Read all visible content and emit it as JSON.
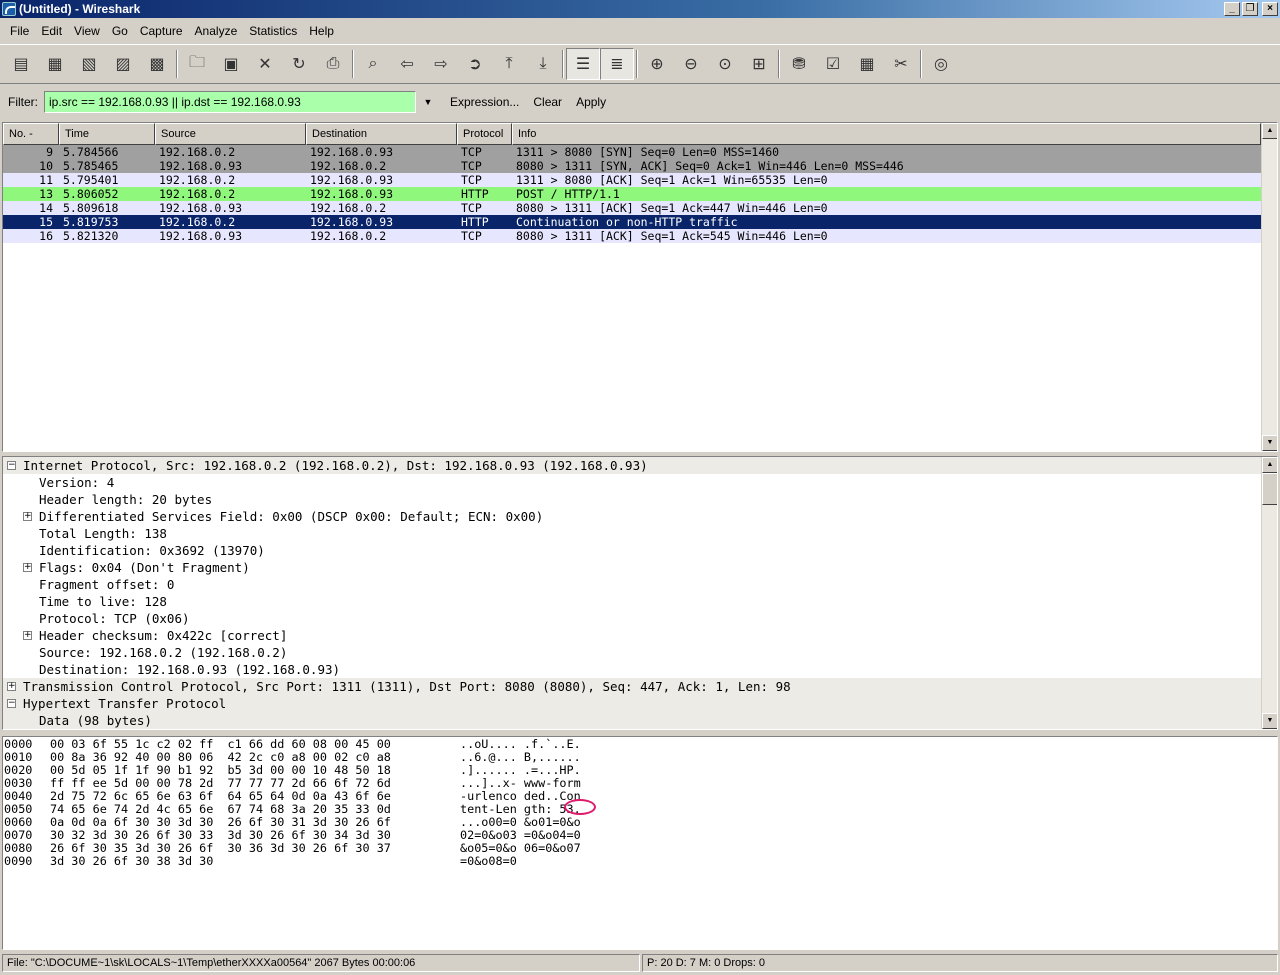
{
  "window": {
    "title": "(Untitled) - Wireshark"
  },
  "menu": [
    "File",
    "Edit",
    "View",
    "Go",
    "Capture",
    "Analyze",
    "Statistics",
    "Help"
  ],
  "filter": {
    "label": "Filter:",
    "value": "ip.src == 192.168.0.93 || ip.dst == 192.168.0.93",
    "expression": "Expression...",
    "clear": "Clear",
    "apply": "Apply"
  },
  "packet_list": {
    "columns": [
      "No. -",
      "Time",
      "Source",
      "Destination",
      "Protocol",
      "Info"
    ],
    "rows": [
      {
        "no": "9",
        "time": "5.784566",
        "src": "192.168.0.2",
        "dst": "192.168.0.93",
        "proto": "TCP",
        "info": "1311 > 8080 [SYN] Seq=0 Len=0 MSS=1460",
        "bg": "#a0a0a0",
        "fg": "#000000"
      },
      {
        "no": "10",
        "time": "5.785465",
        "src": "192.168.0.93",
        "dst": "192.168.0.2",
        "proto": "TCP",
        "info": "8080 > 1311 [SYN, ACK] Seq=0 Ack=1 Win=446 Len=0 MSS=446",
        "bg": "#a0a0a0",
        "fg": "#000000"
      },
      {
        "no": "11",
        "time": "5.795401",
        "src": "192.168.0.2",
        "dst": "192.168.0.93",
        "proto": "TCP",
        "info": "1311 > 8080 [ACK] Seq=1 Ack=1 Win=65535 Len=0",
        "bg": "#e7e6ff",
        "fg": "#000000"
      },
      {
        "no": "13",
        "time": "5.806052",
        "src": "192.168.0.2",
        "dst": "192.168.0.93",
        "proto": "HTTP",
        "info": "POST / HTTP/1.1",
        "bg": "#8ff77c",
        "fg": "#000000"
      },
      {
        "no": "14",
        "time": "5.809618",
        "src": "192.168.0.93",
        "dst": "192.168.0.2",
        "proto": "TCP",
        "info": "8080 > 1311 [ACK] Seq=1 Ack=447 Win=446 Len=0",
        "bg": "#e7e6ff",
        "fg": "#000000"
      },
      {
        "no": "15",
        "time": "5.819753",
        "src": "192.168.0.2",
        "dst": "192.168.0.93",
        "proto": "HTTP",
        "info": "Continuation or non-HTTP traffic",
        "bg": "#0a246a",
        "fg": "#ffffff"
      },
      {
        "no": "16",
        "time": "5.821320",
        "src": "192.168.0.93",
        "dst": "192.168.0.2",
        "proto": "TCP",
        "info": "8080 > 1311 [ACK] Seq=1 Ack=545 Win=446 Len=0",
        "bg": "#e7e6ff",
        "fg": "#000000"
      }
    ]
  },
  "details": [
    {
      "text": "Internet Protocol, Src: 192.168.0.2 (192.168.0.2), Dst: 192.168.0.93 (192.168.0.93)",
      "level": 0,
      "exp": "minus"
    },
    {
      "text": "Version: 4",
      "level": 1,
      "exp": ""
    },
    {
      "text": "Header length: 20 bytes",
      "level": 1,
      "exp": ""
    },
    {
      "text": "Differentiated Services Field: 0x00 (DSCP 0x00: Default; ECN: 0x00)",
      "level": 1,
      "exp": "plus"
    },
    {
      "text": "Total Length: 138",
      "level": 1,
      "exp": ""
    },
    {
      "text": "Identification: 0x3692 (13970)",
      "level": 1,
      "exp": ""
    },
    {
      "text": "Flags: 0x04 (Don't Fragment)",
      "level": 1,
      "exp": "plus"
    },
    {
      "text": "Fragment offset: 0",
      "level": 1,
      "exp": ""
    },
    {
      "text": "Time to live: 128",
      "level": 1,
      "exp": ""
    },
    {
      "text": "Protocol: TCP (0x06)",
      "level": 1,
      "exp": ""
    },
    {
      "text": "Header checksum: 0x422c [correct]",
      "level": 1,
      "exp": "plus"
    },
    {
      "text": "Source: 192.168.0.2 (192.168.0.2)",
      "level": 1,
      "exp": ""
    },
    {
      "text": "Destination: 192.168.0.93 (192.168.0.93)",
      "level": 1,
      "exp": ""
    },
    {
      "text": "Transmission Control Protocol, Src Port: 1311 (1311), Dst Port: 8080 (8080), Seq: 447, Ack: 1, Len: 98",
      "level": 0,
      "exp": "plus"
    },
    {
      "text": "Hypertext Transfer Protocol",
      "level": 0,
      "exp": "minus"
    },
    {
      "text": "Data (98 bytes)",
      "level": 1,
      "exp": "",
      "selected": true
    }
  ],
  "hex": [
    {
      "off": "0000",
      "bytes": "00 03 6f 55 1c c2 02 ff  c1 66 dd 60 08 00 45 00",
      "ascii": "..oU.... .f.`..E."
    },
    {
      "off": "0010",
      "bytes": "00 8a 36 92 40 00 80 06  42 2c c0 a8 00 02 c0 a8",
      "ascii": "..6.@... B,......"
    },
    {
      "off": "0020",
      "bytes": "00 5d 05 1f 1f 90 b1 92  b5 3d 00 00 10 48 50 18",
      "ascii": ".]...... .=...HP."
    },
    {
      "off": "0030",
      "bytes": "ff ff ee 5d 00 00 78 2d  77 77 77 2d 66 6f 72 6d",
      "ascii": "...]..x- www-form"
    },
    {
      "off": "0040",
      "bytes": "2d 75 72 6c 65 6e 63 6f  64 65 64 0d 0a 43 6f 6e",
      "ascii": "-urlenco ded..Con"
    },
    {
      "off": "0050",
      "bytes": "74 65 6e 74 2d 4c 65 6e  67 74 68 3a 20 35 33 0d",
      "ascii": "tent-Len gth: 53."
    },
    {
      "off": "0060",
      "bytes": "0a 0d 0a 6f 30 30 3d 30  26 6f 30 31 3d 30 26 6f",
      "ascii": "...o00=0 &o01=0&o"
    },
    {
      "off": "0070",
      "bytes": "30 32 3d 30 26 6f 30 33  3d 30 26 6f 30 34 3d 30",
      "ascii": "02=0&o03 =0&o04=0"
    },
    {
      "off": "0080",
      "bytes": "26 6f 30 35 3d 30 26 6f  30 36 3d 30 26 6f 30 37",
      "ascii": "&o05=0&o 06=0&o07"
    },
    {
      "off": "0090",
      "bytes": "3d 30 26 6f 30 38 3d 30",
      "ascii": "=0&o08=0"
    }
  ],
  "status": {
    "left": "File: \"C:\\DOCUME~1\\sk\\LOCALS~1\\Temp\\etherXXXXa00564\" 2067 Bytes 00:00:06",
    "right": "P: 20 D: 7 M: 0 Drops: 0"
  },
  "toolbar_icons": [
    "interfaces-icon",
    "options-icon",
    "start-icon",
    "stop-icon",
    "restart-icon",
    "open-icon",
    "save-icon",
    "close-icon",
    "reload-icon",
    "print-icon",
    "find-icon",
    "back-icon",
    "forward-icon",
    "goto-icon",
    "first-icon",
    "last-icon",
    "colorize-icon",
    "autoscroll-icon",
    "zoom-in-icon",
    "zoom-out-icon",
    "zoom-normal-icon",
    "resize-columns-icon",
    "capture-filters-icon",
    "display-filters-icon",
    "coloring-rules-icon",
    "preferences-icon",
    "help-icon"
  ]
}
